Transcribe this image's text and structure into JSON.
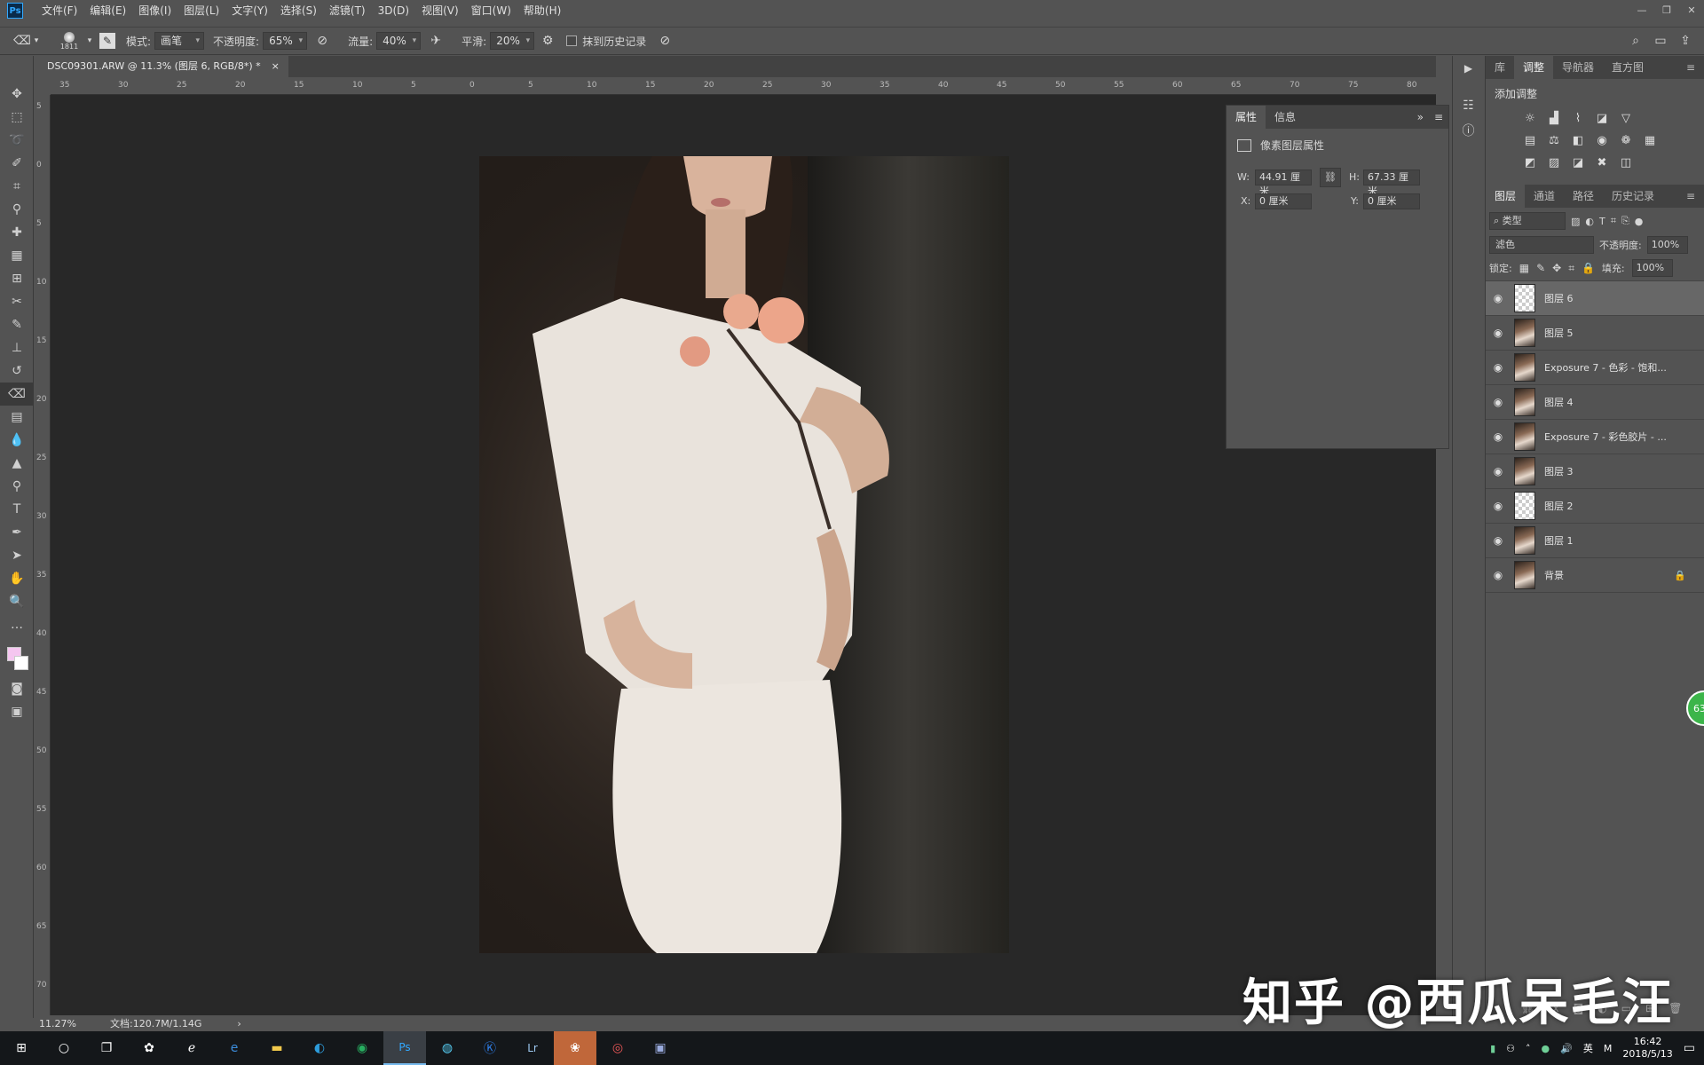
{
  "menubar": {
    "logo": "Ps",
    "items": [
      "文件(F)",
      "编辑(E)",
      "图像(I)",
      "图层(L)",
      "文字(Y)",
      "选择(S)",
      "滤镜(T)",
      "3D(D)",
      "视图(V)",
      "窗口(W)",
      "帮助(H)"
    ],
    "minimize": "—",
    "restore": "❐",
    "close": "✕"
  },
  "options": {
    "brush_size": "1811",
    "mode_label": "模式:",
    "mode_value": "画笔",
    "opacity_label": "不透明度:",
    "opacity_value": "65%",
    "flow_label": "流量:",
    "flow_value": "40%",
    "smooth_label": "平滑:",
    "smooth_value": "20%",
    "history_label": "抹到历史记录"
  },
  "document": {
    "tab_title": "DSC09301.ARW @ 11.3% (图层 6, RGB/8*) *",
    "tab_close": "×",
    "zoom": "11.27%",
    "doc_info": "文档:120.7M/1.14G",
    "info_arrow": "›"
  },
  "ruler": {
    "h_ticks": [
      "35",
      "30",
      "25",
      "20",
      "15",
      "10",
      "5",
      "0",
      "5",
      "10",
      "15",
      "20",
      "25",
      "30",
      "35",
      "40",
      "45",
      "50",
      "55",
      "60",
      "65",
      "70",
      "75",
      "80"
    ],
    "v_ticks": [
      "5",
      "0",
      "5",
      "10",
      "15",
      "20",
      "25",
      "30",
      "35",
      "40",
      "45",
      "50",
      "55",
      "60",
      "65",
      "70"
    ]
  },
  "properties": {
    "tabs": [
      "属性",
      "信息"
    ],
    "section": "像素图层属性",
    "w_label": "W:",
    "w_value": "44.91 厘米",
    "h_label": "H:",
    "h_value": "67.33 厘米",
    "x_label": "X:",
    "x_value": "0 厘米",
    "y_label": "Y:",
    "y_value": "0 厘米"
  },
  "right_top": {
    "tabs": [
      "库",
      "调整",
      "导航器",
      "直方图"
    ],
    "active": "调整",
    "add_adjustment": "添加调整"
  },
  "layers_panel": {
    "tabs": [
      "图层",
      "通道",
      "路径",
      "历史记录"
    ],
    "filter_label": "类型",
    "blend_mode": "滤色",
    "opacity_label": "不透明度:",
    "opacity_value": "100%",
    "lock_label": "锁定:",
    "fill_label": "填充:",
    "fill_value": "100%",
    "layers": [
      {
        "name": "图层 6",
        "selected": true,
        "thumb": "checker"
      },
      {
        "name": "图层 5",
        "selected": false,
        "thumb": "photo"
      },
      {
        "name": "Exposure 7 - 色彩 - 饱和...",
        "selected": false,
        "thumb": "photo"
      },
      {
        "name": "图层 4",
        "selected": false,
        "thumb": "photo"
      },
      {
        "name": "Exposure 7 - 彩色胶片 - ...",
        "selected": false,
        "thumb": "photo"
      },
      {
        "name": "图层 3",
        "selected": false,
        "thumb": "photo"
      },
      {
        "name": "图层 2",
        "selected": false,
        "thumb": "checker"
      },
      {
        "name": "图层 1",
        "selected": false,
        "thumb": "photo"
      },
      {
        "name": "背景",
        "selected": false,
        "thumb": "photo",
        "locked": true
      }
    ]
  },
  "taskbar": {
    "time": "16:42",
    "date": "2018/5/13",
    "ime": "英",
    "apps": [
      "Ps",
      "Lr"
    ]
  },
  "watermark": "知乎 @西瓜呆毛汪",
  "badge": "63"
}
